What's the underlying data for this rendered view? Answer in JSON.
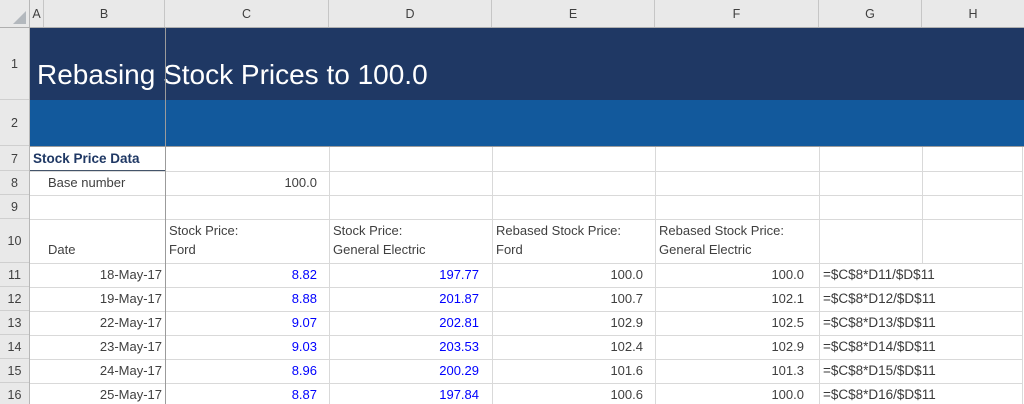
{
  "sheet": {
    "columns": [
      "A",
      "B",
      "C",
      "D",
      "E",
      "F",
      "G",
      "H"
    ],
    "rows": [
      "1",
      "2",
      "7",
      "8",
      "9",
      "10",
      "11",
      "12",
      "13",
      "14",
      "15",
      "16"
    ]
  },
  "banner": {
    "title": "Rebasing Stock Prices to 100.0"
  },
  "section": {
    "heading": "Stock Price Data",
    "base_label": "Base number",
    "base_value": "100.0"
  },
  "table": {
    "headers": {
      "date": "Date",
      "ford_l1": "Stock Price:",
      "ford_l2": "Ford",
      "ge_l1": "Stock Price:",
      "ge_l2": "General Electric",
      "rford_l1": "Rebased Stock Price:",
      "rford_l2": "Ford",
      "rge_l1": "Rebased Stock Price:",
      "rge_l2": "General Electric"
    },
    "rows": [
      {
        "date": "18-May-17",
        "ford": "8.82",
        "ge": "197.77",
        "rford": "100.0",
        "rge": "100.0",
        "formula": "=$C$8*D11/$D$11"
      },
      {
        "date": "19-May-17",
        "ford": "8.88",
        "ge": "201.87",
        "rford": "100.7",
        "rge": "102.1",
        "formula": "=$C$8*D12/$D$11"
      },
      {
        "date": "22-May-17",
        "ford": "9.07",
        "ge": "202.81",
        "rford": "102.9",
        "rge": "102.5",
        "formula": "=$C$8*D13/$D$11"
      },
      {
        "date": "23-May-17",
        "ford": "9.03",
        "ge": "203.53",
        "rford": "102.4",
        "rge": "102.9",
        "formula": "=$C$8*D14/$D$11"
      },
      {
        "date": "24-May-17",
        "ford": "8.96",
        "ge": "200.29",
        "rford": "101.6",
        "rge": "101.3",
        "formula": "=$C$8*D15/$D$11"
      },
      {
        "date": "25-May-17",
        "ford": "8.87",
        "ge": "197.84",
        "rford": "100.6",
        "rge": "100.0",
        "formula": "=$C$8*D16/$D$11"
      }
    ]
  },
  "colors": {
    "banner_dark": "#1F3864",
    "banner_blue": "#12599C",
    "input_blue": "#0000FF",
    "heading_navy": "#1F3864",
    "cell_text": "#3F3F3F",
    "gridline": "#D9D9D9"
  }
}
